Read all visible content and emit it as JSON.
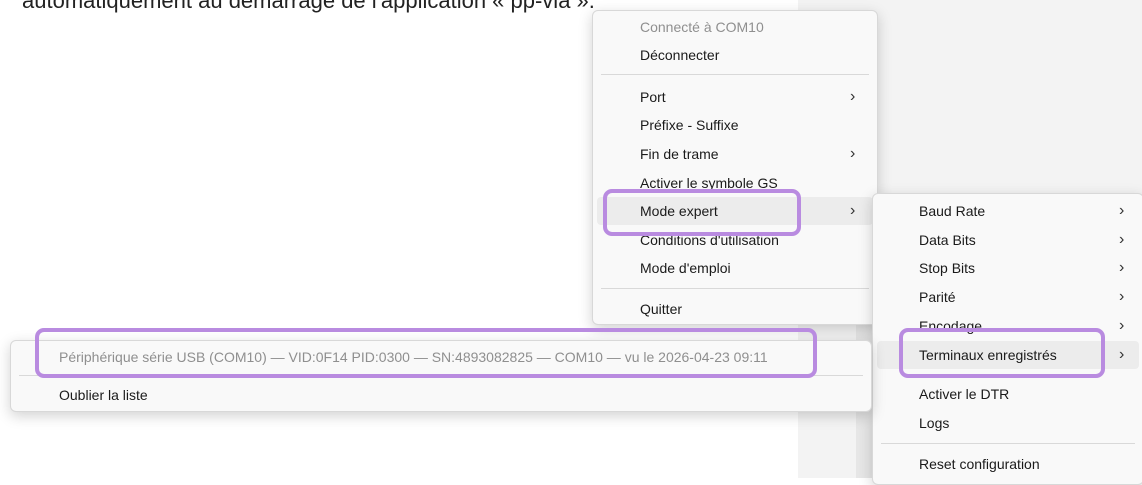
{
  "document": {
    "text": "automatiquement au démarrage de l'application « pp-via »."
  },
  "main_menu": {
    "items": [
      {
        "label": "Connecté à COM10",
        "disabled": true
      },
      {
        "label": "Déconnecter"
      },
      {
        "label": "Port",
        "submenu": true
      },
      {
        "label": "Préfixe - Suffixe"
      },
      {
        "label": "Fin de trame",
        "submenu": true
      },
      {
        "label": "Activer le symbole GS"
      },
      {
        "label": "Mode expert",
        "submenu": true
      },
      {
        "label": "Conditions d'utilisation"
      },
      {
        "label": "Mode d'emploi"
      },
      {
        "label": "Quitter"
      }
    ]
  },
  "expert_menu": {
    "items": [
      {
        "label": "Baud Rate",
        "submenu": true
      },
      {
        "label": "Data Bits",
        "submenu": true
      },
      {
        "label": "Stop Bits",
        "submenu": true
      },
      {
        "label": "Parité",
        "submenu": true
      },
      {
        "label": "Encodage",
        "submenu": true
      },
      {
        "label": "Terminaux enregistrés",
        "submenu": true
      },
      {
        "label": "Activer le DTR"
      },
      {
        "label": "Logs"
      },
      {
        "label": "Reset configuration"
      }
    ]
  },
  "terminals_menu": {
    "items": [
      {
        "label": "Périphérique série USB (COM10) — VID:0F14 PID:0300 — SN:4893082825 — COM10 — vu le 2026-04-23 09:11",
        "disabled": true
      },
      {
        "label": "Oublier la liste"
      }
    ]
  },
  "icons": {
    "submenu_chevron": "›"
  },
  "colors": {
    "highlight": "#b98be0",
    "menu_bg": "#f9f9f9",
    "hover_bg": "#ececec",
    "disabled_text": "#8f8f8f"
  }
}
